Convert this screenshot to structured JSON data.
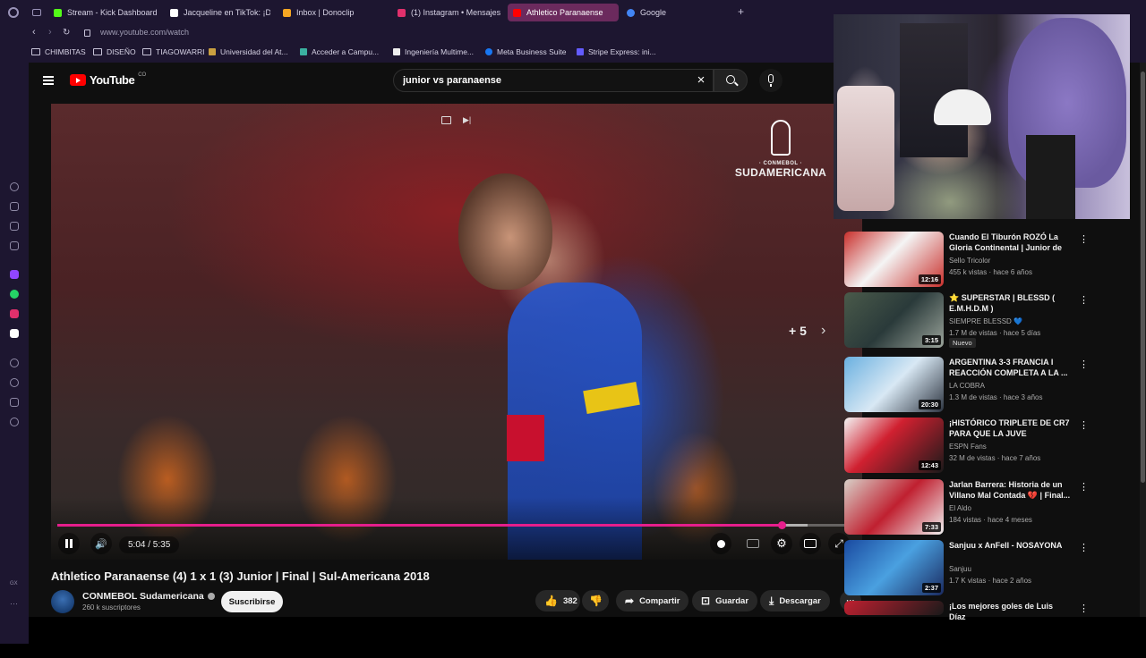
{
  "browser": {
    "tabs": [
      {
        "label": "Stream - Kick Dashboard",
        "color": "#53fc18"
      },
      {
        "label": "Jacqueline en TikTok: ¡De",
        "color": "#ffffff"
      },
      {
        "label": "Inbox | Donoclip",
        "color": "#f5a623"
      },
      {
        "label": "(1) Instagram • Mensajes",
        "color": "#e1306c"
      },
      {
        "label": "Athletico Paranaense",
        "color": "#ff0000"
      },
      {
        "label": "Google",
        "color": "#4285f4"
      }
    ],
    "url": "www.youtube.com/watch",
    "bookmarks": [
      "CHIMBITAS",
      "DISEÑO",
      "TIAGOWARRI",
      "Universidad del At...",
      "Acceder a Campu...",
      "Ingeniería Multime...",
      "Meta Business Suite",
      "Stripe Express: ini..."
    ]
  },
  "youtube": {
    "logo": "YouTube",
    "region": "CO",
    "search_query": "junior vs paranaense"
  },
  "player": {
    "brand_small": "· CONMEBOL ·",
    "brand_big": "SUDAMERICANA",
    "more_count": "+ 5",
    "time": "5:04 / 5:35",
    "progress": 0.907,
    "buffered": 0.94
  },
  "video": {
    "title": "Athletico Paranaense (4) 1 x 1 (3) Junior | Final | Sul-Americana 2018",
    "channel": "CONMEBOL Sudamericana",
    "subscribers": "260 k suscriptores",
    "subscribe_label": "Suscribirse",
    "likes": "382",
    "share_label": "Compartir",
    "save_label": "Guardar",
    "download_label": "Descargar"
  },
  "recommendations": [
    {
      "title": "Cuando El Tiburón ROZÓ La Gloria Continental | Junior de ...",
      "channel": "Sello Tricolor",
      "meta": "455 k vistas · hace 6 años",
      "duration": "12:16",
      "badge": ""
    },
    {
      "title": "⭐ SUPERSTAR | BLESSD ( E.M.H.D.M )",
      "channel": "SIEMPRE BLESSD 💙",
      "meta": "1.7 M de vistas · hace 5 días",
      "duration": "3:15",
      "badge": "Nuevo"
    },
    {
      "title": "ARGENTINA 3-3 FRANCIA I REACCIÓN COMPLETA A LA ...",
      "channel": "LA COBRA",
      "meta": "1.3 M de vistas · hace 3 años",
      "duration": "20:30",
      "badge": ""
    },
    {
      "title": "¡HISTÓRICO TRIPLETE DE CR7 PARA QUE LA JUVE REMONTE...",
      "channel": "ESPN Fans",
      "meta": "32 M de vistas · hace 7 años",
      "duration": "12:43",
      "badge": ""
    },
    {
      "title": "Jarlan Barrera: Historia de un Villano Mal Contada 💔 | Final...",
      "channel": "El Aldo",
      "meta": "184 vistas · hace 4 meses",
      "duration": "7:33",
      "badge": ""
    },
    {
      "title": "Sanjuu x AnFell - NOSAYONA",
      "channel": "Sanjuu",
      "meta": "1.7 K vistas · hace 2 años",
      "duration": "2:37",
      "badge": ""
    },
    {
      "title": "¡Los mejores goles de Luis Díaz",
      "channel": "",
      "meta": "",
      "duration": "",
      "badge": ""
    }
  ]
}
